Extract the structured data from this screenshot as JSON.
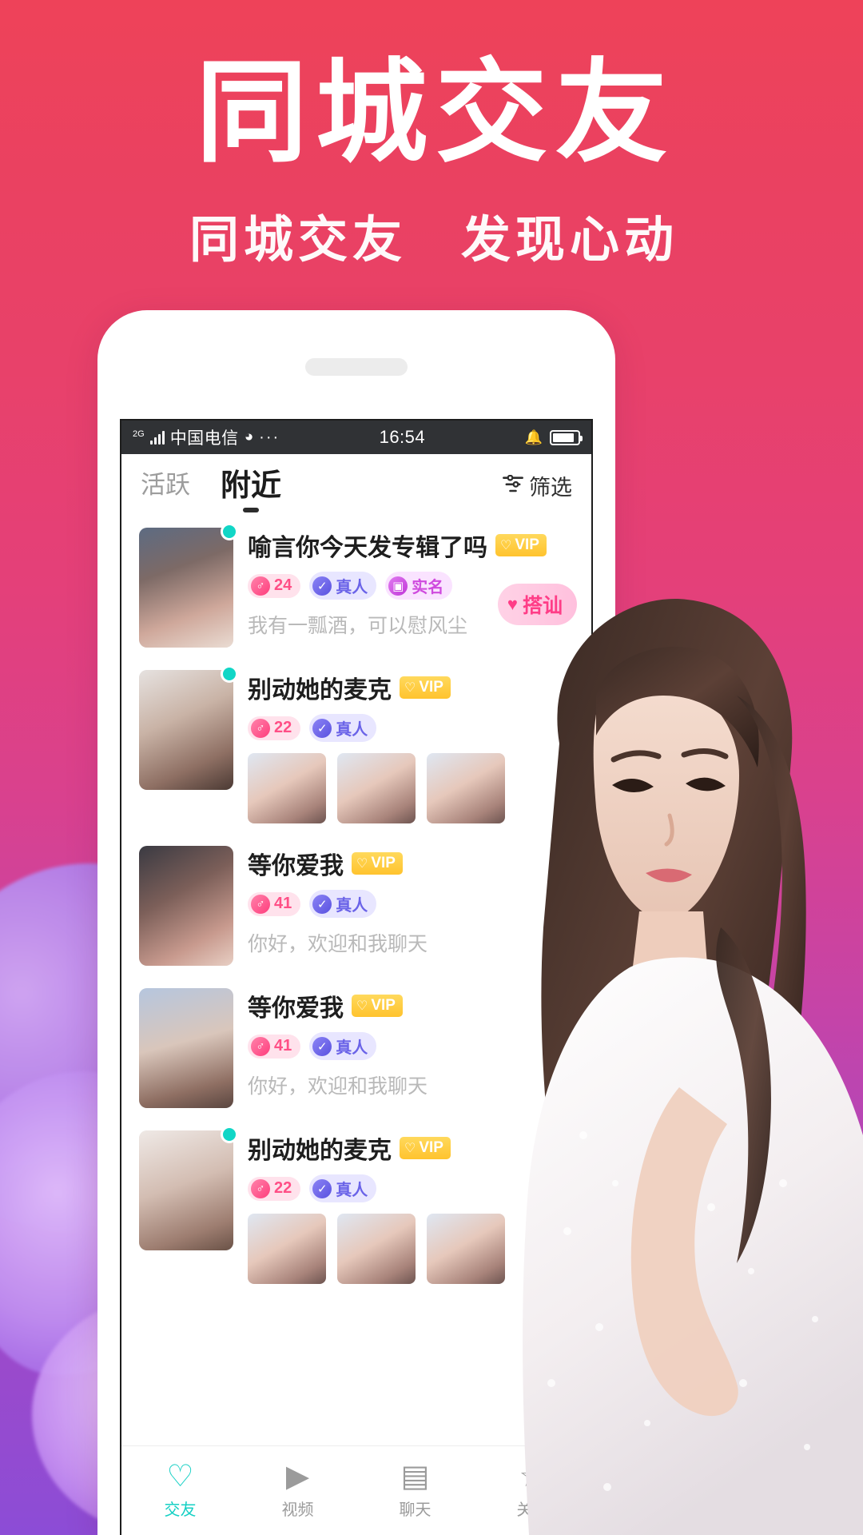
{
  "promo": {
    "title": "同城交友",
    "subtitle": "同城交友　发现心动"
  },
  "status_bar": {
    "network_gen": "2G",
    "carrier": "中国电信",
    "wifi_icon": "wifi-icon",
    "more_dots": "···",
    "time": "16:54",
    "bell_icon": "bell-mute-icon",
    "battery_icon": "battery-icon"
  },
  "app_header": {
    "tabs": [
      {
        "label": "活跃",
        "active": false
      },
      {
        "label": "附近",
        "active": true
      }
    ],
    "filter": {
      "icon": "filter-icon",
      "label": "筛选"
    }
  },
  "chat_button": {
    "icon": "heartbeat-icon",
    "label": "搭讪"
  },
  "users": [
    {
      "name": "喻言你今天发专辑了吗",
      "vip": "VIP",
      "online": true,
      "tags": [
        {
          "type": "age",
          "icon": "male-icon",
          "label": "24"
        },
        {
          "type": "real",
          "icon": "check-icon",
          "label": "真人"
        },
        {
          "type": "id",
          "icon": "idcard-icon",
          "label": "实名"
        }
      ],
      "desc": "我有一瓢酒，可以慰风尘",
      "thumbs": 0
    },
    {
      "name": "别动她的麦克",
      "vip": "VIP",
      "online": true,
      "tags": [
        {
          "type": "age",
          "icon": "male-icon",
          "label": "22"
        },
        {
          "type": "real",
          "icon": "check-icon",
          "label": "真人"
        }
      ],
      "desc": "",
      "thumbs": 3
    },
    {
      "name": "等你爱我",
      "vip": "VIP",
      "online": false,
      "tags": [
        {
          "type": "age",
          "icon": "male-icon",
          "label": "41"
        },
        {
          "type": "real",
          "icon": "check-icon",
          "label": "真人"
        }
      ],
      "desc": "你好，欢迎和我聊天",
      "thumbs": 0
    },
    {
      "name": "等你爱我",
      "vip": "VIP",
      "online": false,
      "tags": [
        {
          "type": "age",
          "icon": "male-icon",
          "label": "41"
        },
        {
          "type": "real",
          "icon": "check-icon",
          "label": "真人"
        }
      ],
      "desc": "你好，欢迎和我聊天",
      "thumbs": 0
    },
    {
      "name": "别动她的麦克",
      "vip": "VIP",
      "online": true,
      "tags": [
        {
          "type": "age",
          "icon": "male-icon",
          "label": "22"
        },
        {
          "type": "real",
          "icon": "check-icon",
          "label": "真人"
        }
      ],
      "desc": "",
      "thumbs": 3
    }
  ],
  "bottom_nav": [
    {
      "icon": "heart-icon",
      "label": "交友",
      "active": true
    },
    {
      "icon": "video-icon",
      "label": "视频",
      "active": false
    },
    {
      "icon": "message-icon",
      "label": "聊天",
      "active": false
    },
    {
      "icon": "star-icon",
      "label": "关注",
      "active": false
    }
  ],
  "colors": {
    "brand_pink": "#ee4259",
    "brand_purple": "#8c4cd6",
    "accent_teal": "#15d0c4",
    "vip_gold": "#ffc32e",
    "chat_pink": "#ff3d87"
  }
}
